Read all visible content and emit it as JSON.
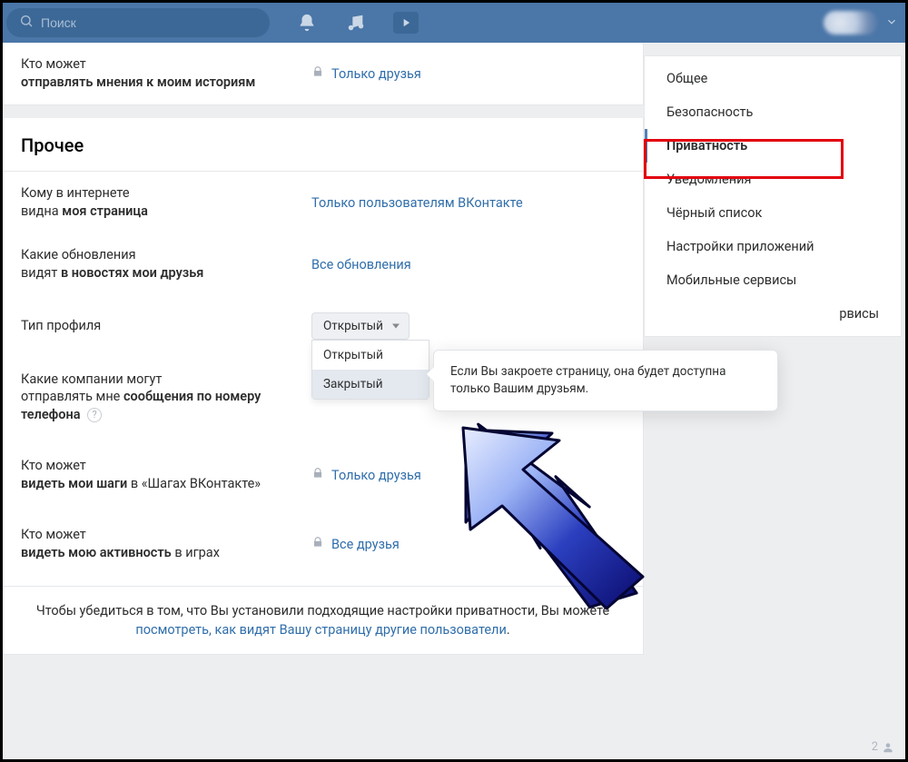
{
  "header": {
    "search_placeholder": "Поиск"
  },
  "top_block": {
    "left_line1": "Кто может",
    "left_line2_bold": "отправлять мнения к моим историям",
    "value": "Только друзья"
  },
  "section_other_title": "Прочее",
  "rows": {
    "r1": {
      "l1": "Кому в интернете",
      "l2a": "видна ",
      "l2b_bold": "моя страница",
      "value": "Только пользователям ВКонтакте"
    },
    "r2": {
      "l1": "Какие обновления",
      "l2a": "видят ",
      "l2b_bold": "в новостях мои друзья",
      "value": "Все обновления"
    },
    "r3": {
      "l1": "Тип профиля",
      "dd_selected": "Открытый",
      "dd_opt1": "Открытый",
      "dd_opt2": "Закрытый"
    },
    "r4": {
      "l1": "Какие компании могут",
      "l2a": "отправлять мне ",
      "l2b_bold": "сообщения по номеру телефона"
    },
    "r5": {
      "l1": "Кто может",
      "l2b_bold": "видеть мои шаги",
      "l2c": " в «Шагах ВКонтакте»",
      "value": "Только друзья"
    },
    "r6": {
      "l1": "Кто может",
      "l2b_bold": "видеть мою активность",
      "l2c": " в играх",
      "value": "Все друзья"
    }
  },
  "tooltip_text": "Если Вы закроете страницу, она будет доступна только Вашим друзьям.",
  "footnote": {
    "text_a": "Чтобы убедиться в том, что Вы установили подходящие настройки приватности, Вы можете ",
    "link": "посмотреть, как видят Вашу страницу другие пользователи",
    "text_b": "."
  },
  "sidebar": {
    "items": [
      "Общее",
      "Безопасность",
      "Приватность",
      "Уведомления",
      "Чёрный список",
      "Настройки приложений",
      "Мобильные сервисы",
      "рвисы"
    ],
    "active_index": 2
  },
  "bottom_badge_count": "2"
}
